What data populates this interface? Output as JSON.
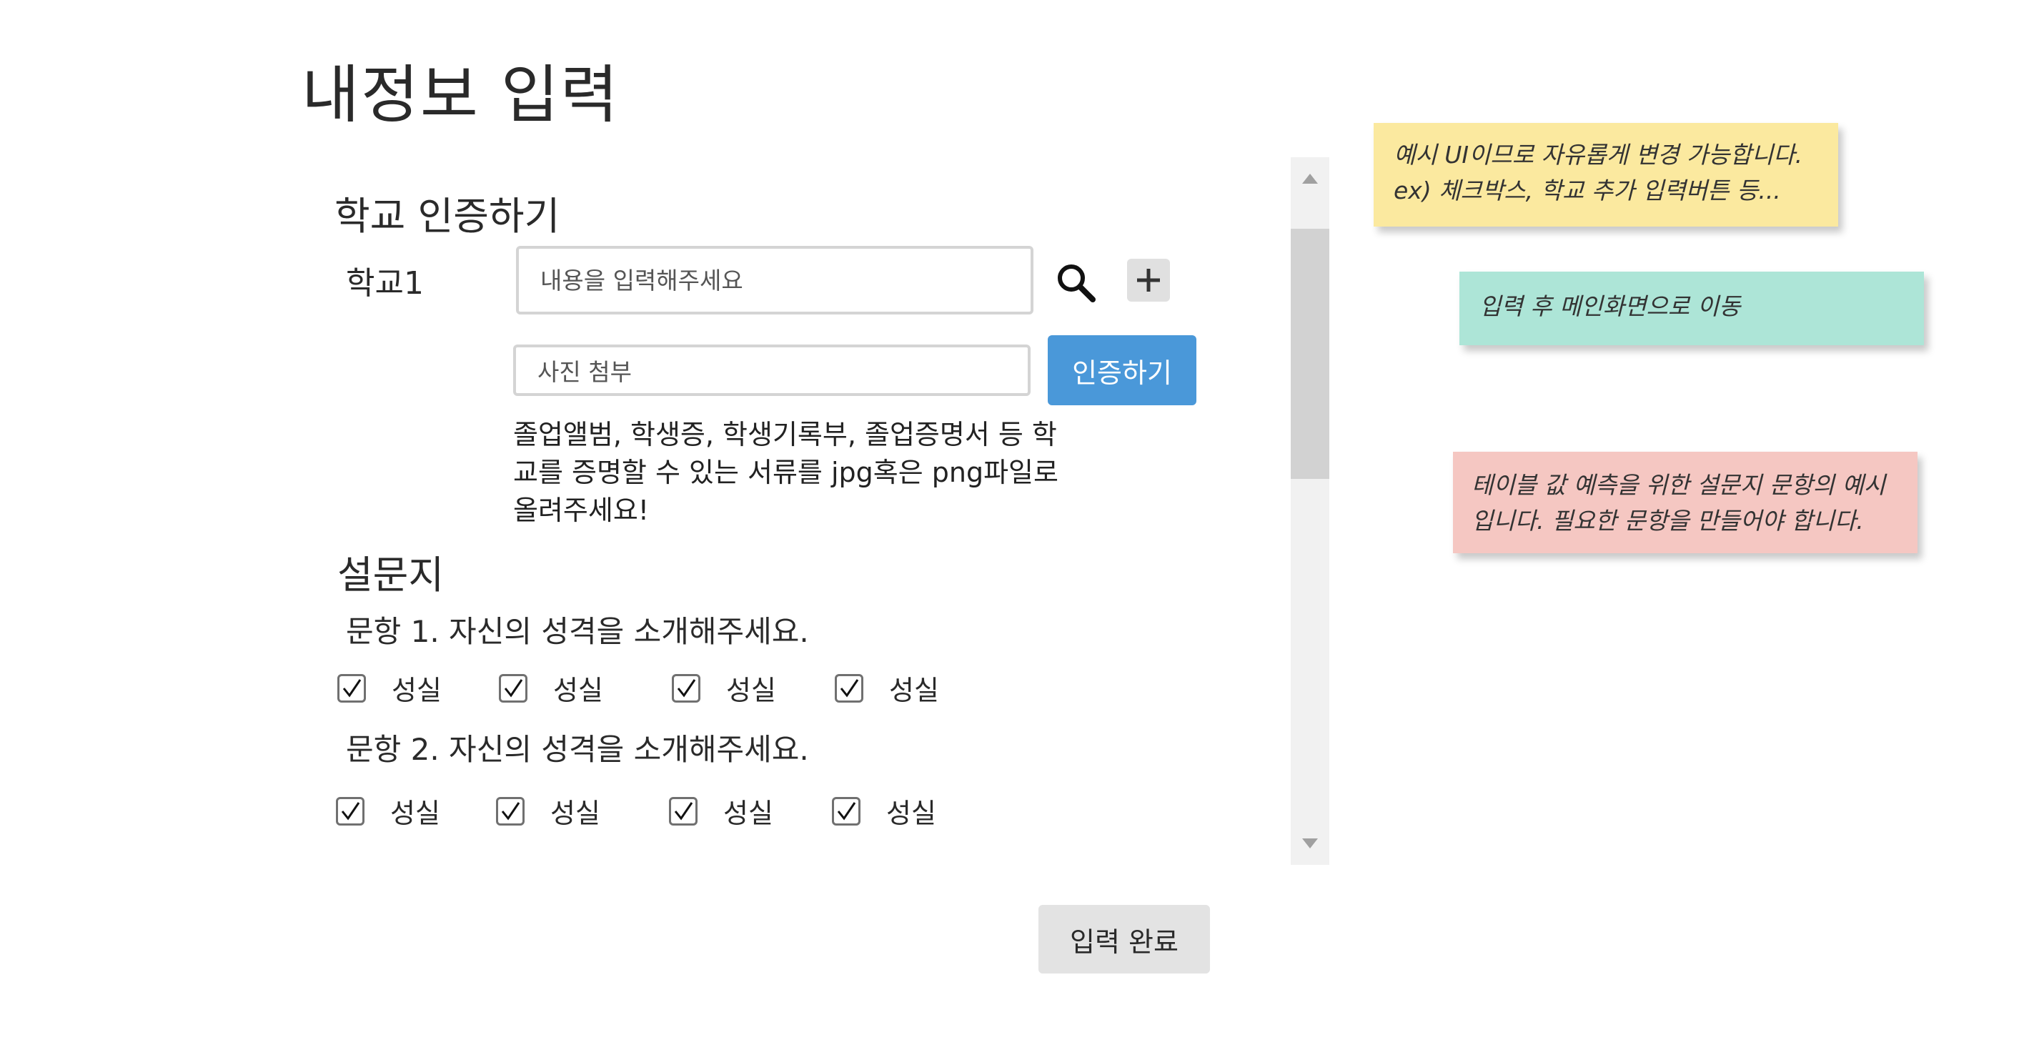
{
  "page": {
    "title": "내정보 입력"
  },
  "school_section": {
    "title": "학교 인증하기",
    "school_label": "학교1",
    "school_input_placeholder": "내용을 입력해주세요",
    "photo_input_value": "사진 첨부",
    "verify_label": "인증하기",
    "help_text": "졸업앨범, 학생증, 학생기록부, 졸업증명서 등 학교를 증명할 수 있는 서류를 jpg혹은 png파일로 올려주세요!",
    "icons": {
      "search": "search-icon",
      "add": "plus-icon"
    }
  },
  "survey": {
    "title": "설문지",
    "questions": [
      {
        "text": "문항 1. 자신의 성격을 소개해주세요.",
        "options": [
          {
            "label": "성실",
            "checked": true
          },
          {
            "label": "성실",
            "checked": true
          },
          {
            "label": "성실",
            "checked": true
          },
          {
            "label": "성실",
            "checked": true
          }
        ]
      },
      {
        "text": "문항 2. 자신의 성격을 소개해주세요.",
        "options": [
          {
            "label": "성실",
            "checked": true
          },
          {
            "label": "성실",
            "checked": true
          },
          {
            "label": "성실",
            "checked": true
          },
          {
            "label": "성실",
            "checked": true
          }
        ]
      }
    ]
  },
  "actions": {
    "submit_label": "입력 완료"
  },
  "notes": [
    {
      "text_line1": "예시 UI이므로 자유롭게 변경 가능합니다.",
      "text_line2": "ex) 체크박스, 학교 추가 입력버튼 등...",
      "color": "#fbe99f"
    },
    {
      "text_line1": "입력 후 메인화면으로 이동",
      "color": "#ade5d7"
    },
    {
      "text_line1": "테이블 값 예측을 위한 설문지 문항의 예시",
      "text_line2": "입니다. 필요한 문항을 만들어야 합니다.",
      "color": "#f5c7c2"
    }
  ],
  "colors": {
    "accent": "#4a98d9",
    "button_gray": "#e3e3e3",
    "scroll_track": "#f1f1f1",
    "scroll_thumb": "#d2d2d2"
  }
}
